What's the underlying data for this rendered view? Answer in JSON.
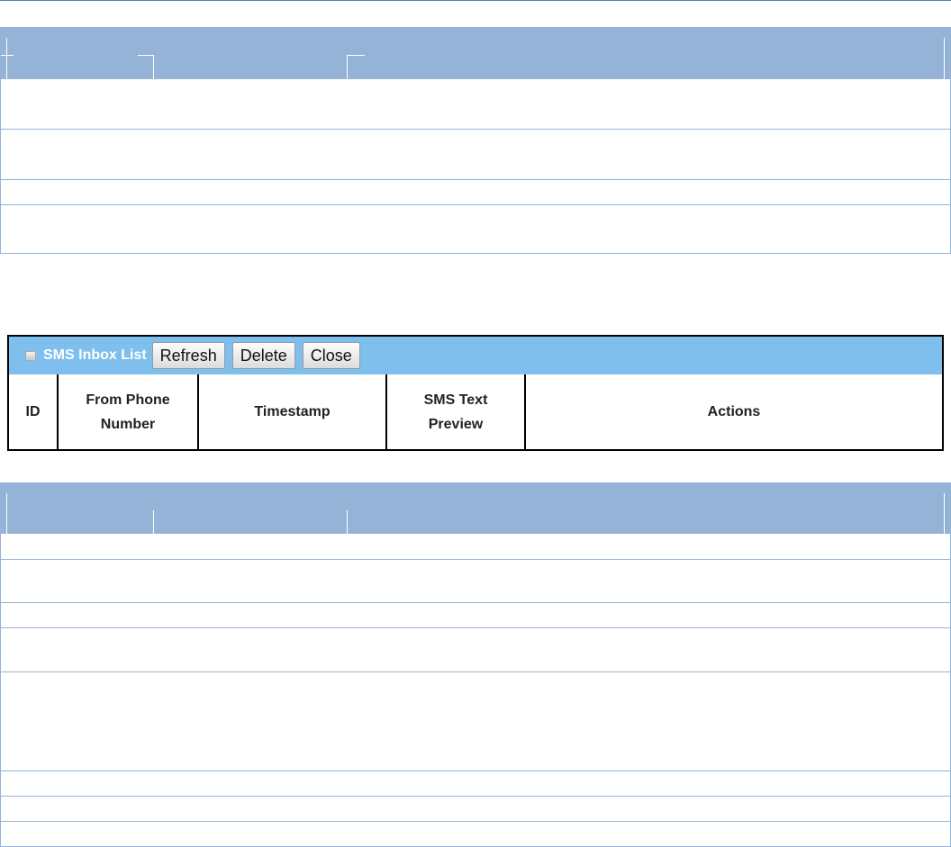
{
  "sms_inbox": {
    "title": "SMS Inbox List",
    "buttons": {
      "refresh": "Refresh",
      "delete": "Delete",
      "close": "Close"
    },
    "columns": {
      "id": "ID",
      "from_phone": "From Phone\nNumber",
      "timestamp": "Timestamp",
      "sms_text_preview": "SMS Text\nPreview",
      "actions": "Actions"
    }
  },
  "colors": {
    "table_header": "#95b3d7",
    "panel_titlebar": "#7fbfed",
    "panel_border": "#000000"
  }
}
